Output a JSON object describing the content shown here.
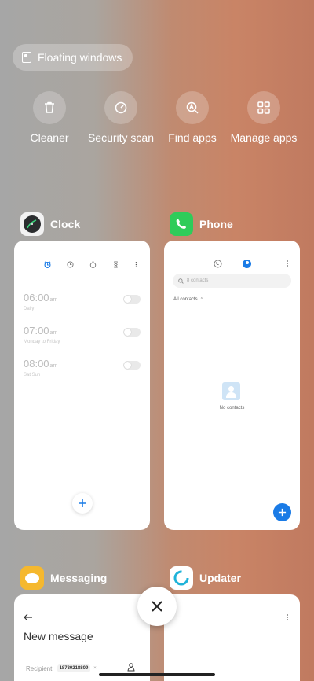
{
  "header": {
    "floating_label": "Floating windows"
  },
  "quick_actions": [
    {
      "label": "Cleaner",
      "icon": "trash-icon"
    },
    {
      "label": "Security scan",
      "icon": "shield-check-icon"
    },
    {
      "label": "Find apps",
      "icon": "search-apps-icon"
    },
    {
      "label": "Manage apps",
      "icon": "grid-icon"
    }
  ],
  "apps": {
    "clock": {
      "name": "Clock",
      "alarms": [
        {
          "time": "06:00",
          "ampm": "am",
          "repeat": "Daily"
        },
        {
          "time": "07:00",
          "ampm": "am",
          "repeat": "Monday to Friday"
        },
        {
          "time": "08:00",
          "ampm": "am",
          "repeat": "Sat Sun"
        }
      ]
    },
    "phone": {
      "name": "Phone",
      "search_placeholder": "8 contacts",
      "filter_label": "All contacts",
      "empty_text": "No contacts"
    },
    "messaging": {
      "name": "Messaging",
      "title": "New message",
      "recipient_label": "Recipient:",
      "recipient_value": "18730218809"
    },
    "updater": {
      "name": "Updater"
    }
  },
  "colors": {
    "accent": "#1a7be6",
    "phone_green": "#2ecc5a",
    "messaging_yellow": "#f5b82e"
  }
}
